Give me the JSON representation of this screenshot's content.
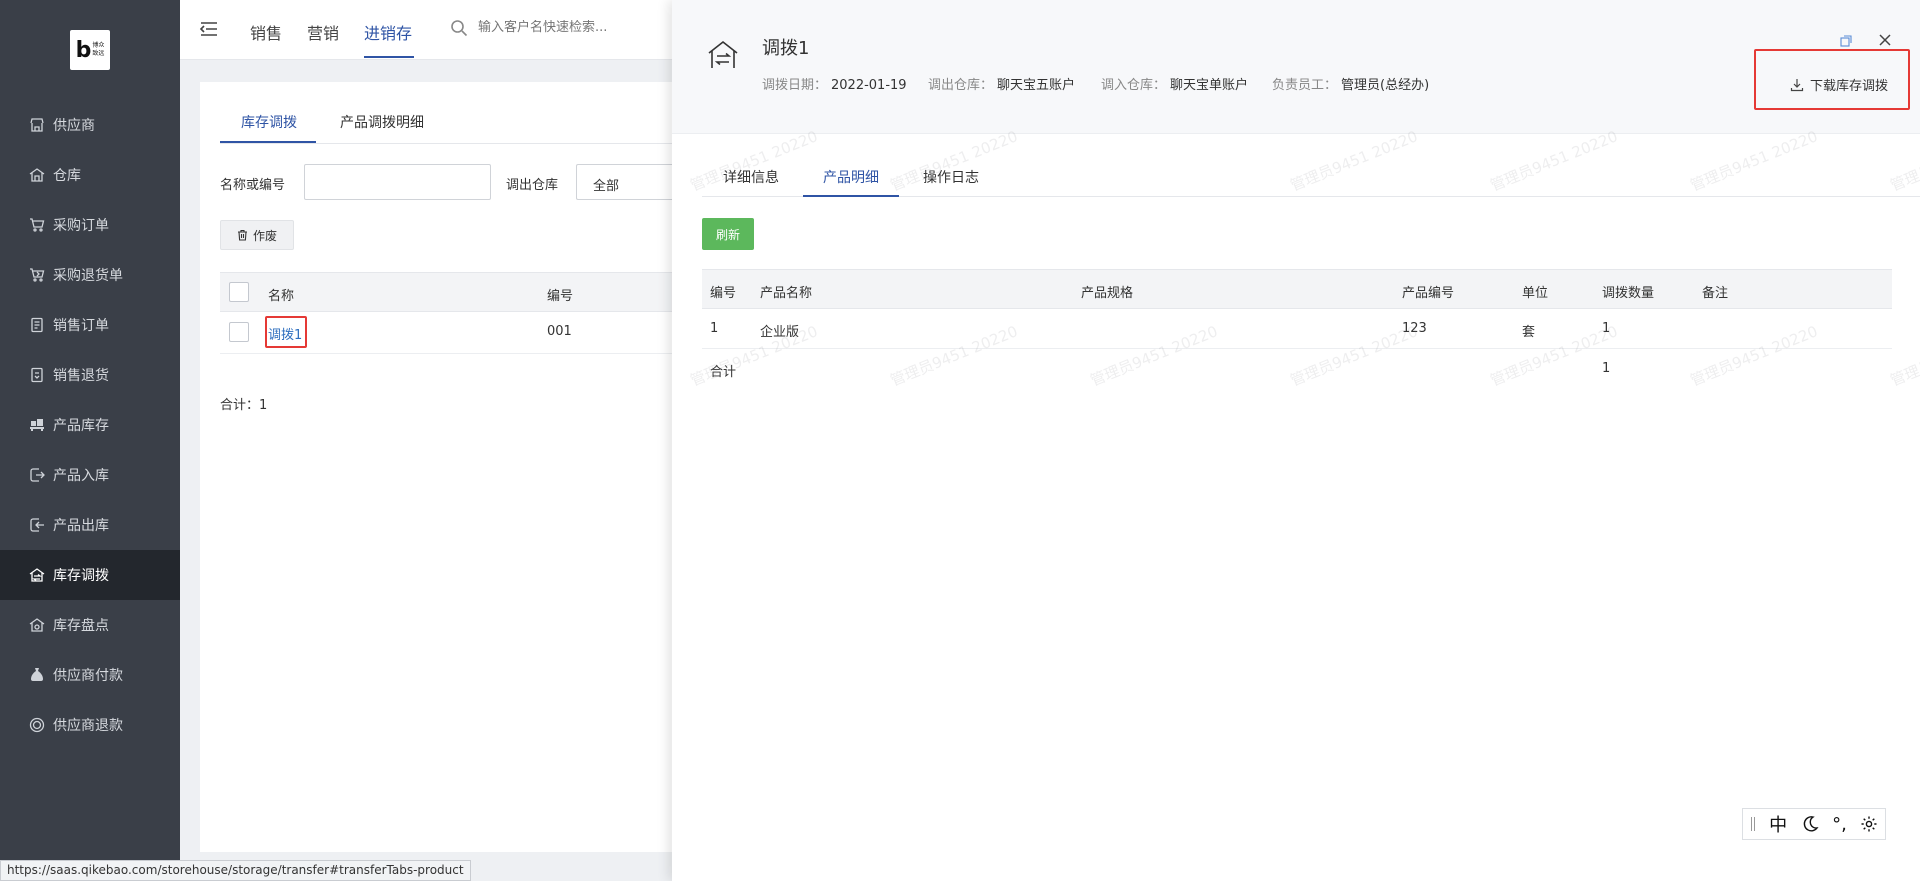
{
  "sidebar": {
    "logo": {
      "letter": "b",
      "text": "博众致远"
    },
    "items": [
      {
        "label": "供应商",
        "icon": "store-icon"
      },
      {
        "label": "仓库",
        "icon": "warehouse-icon"
      },
      {
        "label": "采购订单",
        "icon": "cart-icon"
      },
      {
        "label": "采购退货单",
        "icon": "cart-return-icon"
      },
      {
        "label": "销售订单",
        "icon": "document-icon"
      },
      {
        "label": "销售退货",
        "icon": "document-return-icon"
      },
      {
        "label": "产品库存",
        "icon": "inventory-icon"
      },
      {
        "label": "产品入库",
        "icon": "stock-in-icon"
      },
      {
        "label": "产品出库",
        "icon": "stock-out-icon"
      },
      {
        "label": "库存调拨",
        "icon": "transfer-icon",
        "active": true
      },
      {
        "label": "库存盘点",
        "icon": "stocktake-icon"
      },
      {
        "label": "供应商付款",
        "icon": "money-bag-icon"
      },
      {
        "label": "供应商退款",
        "icon": "refund-icon"
      }
    ]
  },
  "topbar": {
    "tabs": [
      "销售",
      "营销",
      "进销存"
    ],
    "active_tab": "进销存",
    "search_placeholder": "输入客户名快速检索..."
  },
  "main": {
    "tabs": [
      "库存调拨",
      "产品调拨明细"
    ],
    "filter": {
      "name_label": "名称或编号",
      "warehouse_label": "调出仓库",
      "warehouse_value": "全部"
    },
    "void_button": "作废",
    "table": {
      "headers": [
        "名称",
        "编号"
      ],
      "rows": [
        {
          "name": "调拨1",
          "code": "001"
        }
      ]
    },
    "total": "合计：1"
  },
  "status_url": "https://saas.qikebao.com/storehouse/storage/transfer#transferTabs-product",
  "drawer": {
    "title": "调拨1",
    "meta": [
      {
        "key": "调拨日期：",
        "value": "2022-01-19"
      },
      {
        "key": "调出仓库：",
        "value": "聊天宝五账户"
      },
      {
        "key": "调入仓库：",
        "value": "聊天宝单账户"
      },
      {
        "key": "负责员工：",
        "value": "管理员(总经办)"
      }
    ],
    "download_label": "下载库存调拨",
    "tabs": [
      "详细信息",
      "产品明细",
      "操作日志"
    ],
    "active_tab": "产品明细",
    "refresh_label": "刷新",
    "product_table": {
      "headers": [
        "编号",
        "产品名称",
        "产品规格",
        "产品编号",
        "单位",
        "调拨数量",
        "备注"
      ],
      "rows": [
        {
          "no": "1",
          "name": "企业版",
          "spec": "",
          "code": "123",
          "unit": "套",
          "qty": "1",
          "remark": ""
        }
      ],
      "summary": {
        "label": "合计",
        "qty": "1"
      }
    },
    "watermark": "管理员9451 20220"
  },
  "ime": {
    "mode": "中",
    "punct": "°,"
  },
  "colors": {
    "sidebar_bg": "#3a3f48",
    "accent": "#2f54a5",
    "link": "#2f6fbf",
    "refresh": "#5cb85c",
    "highlight": "#e53935"
  }
}
